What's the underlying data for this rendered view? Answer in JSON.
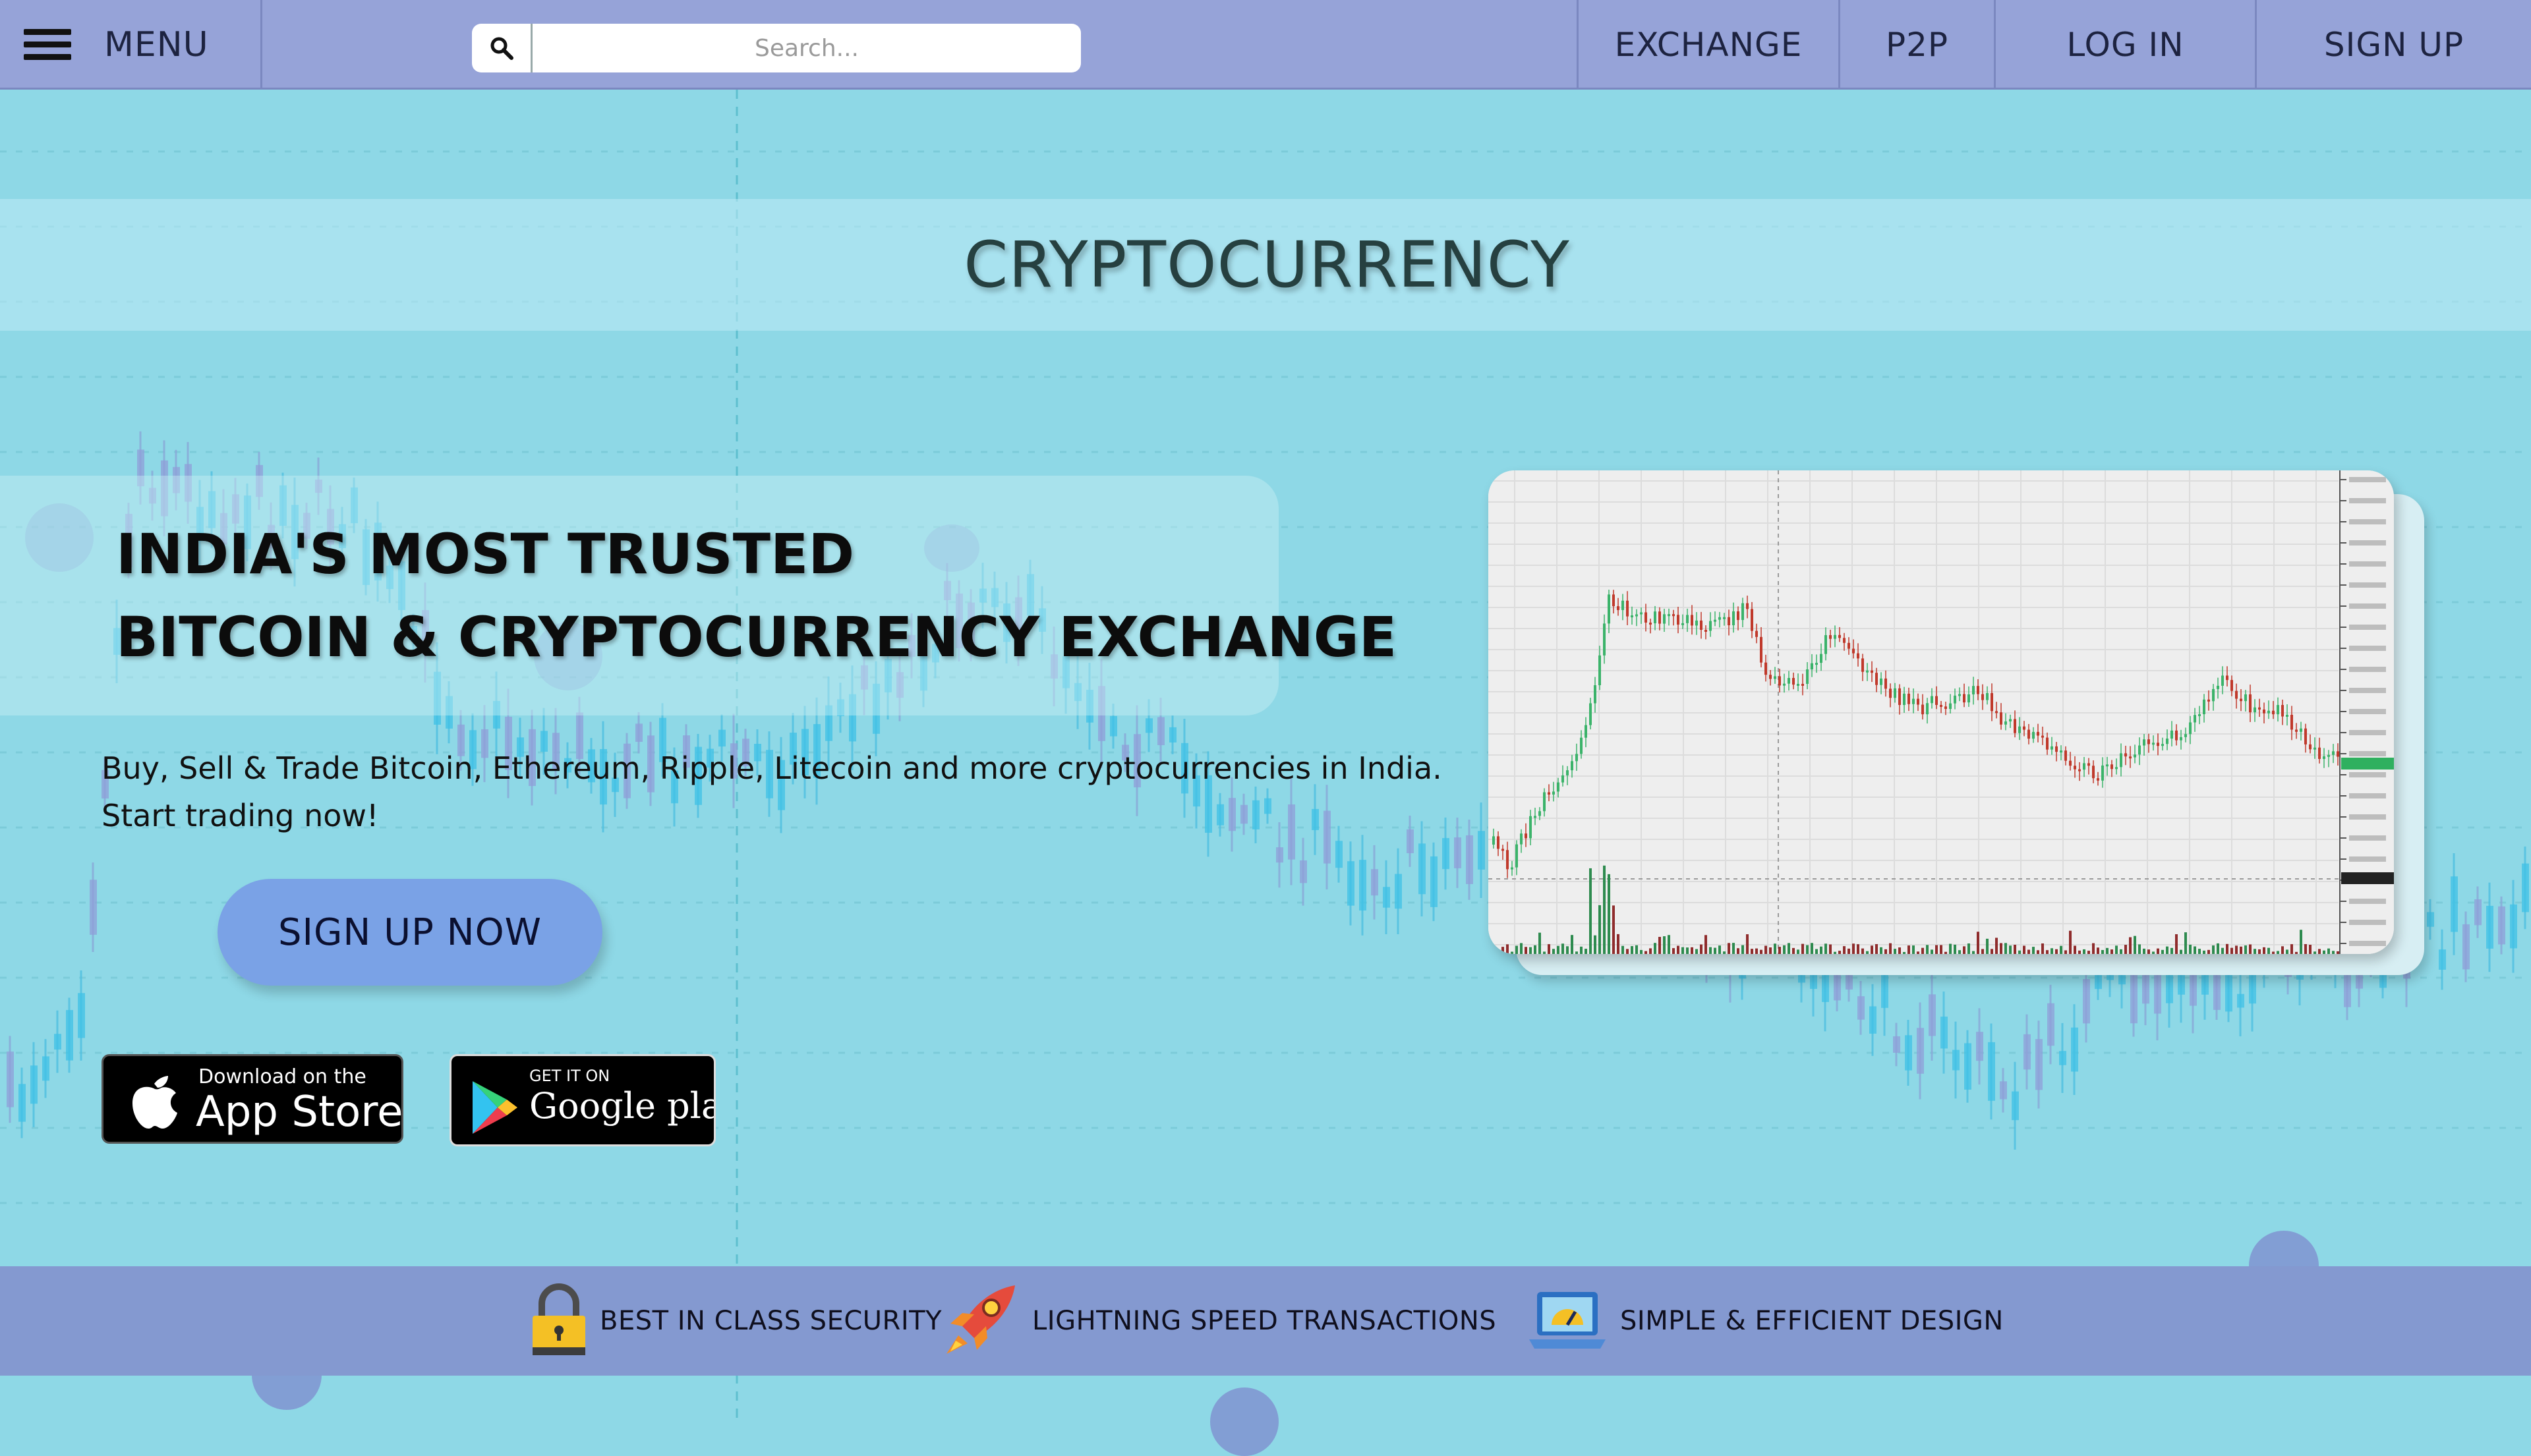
{
  "nav": {
    "menu_label": "MENU",
    "search_placeholder": "Search...",
    "links": {
      "exchange": "EXCHANGE",
      "p2p": "P2P",
      "login": "LOG IN",
      "signup": "SIGN UP"
    }
  },
  "hero": {
    "title": "CRYPTOCURRENCY",
    "headline_line1": "INDIA'S MOST TRUSTED",
    "headline_line2": "BITCOIN & CRYPTOCURRENCY EXCHANGE",
    "tagline_line1": "Buy, Sell & Trade Bitcoin, Ethereum, Ripple, Litecoin and more cryptocurrencies in India.",
    "tagline_line2": "Start trading now!",
    "cta_label": "SIGN UP NOW"
  },
  "store_badges": {
    "appstore_small": "Download on the",
    "appstore_big": "App Store",
    "googleplay_small": "GET IT ON",
    "googleplay_big": "Google play"
  },
  "features": [
    {
      "icon": "padlock-icon",
      "label": "BEST IN CLASS SECURITY"
    },
    {
      "icon": "rocket-icon",
      "label": "LIGHTNING SPEED TRANSACTIONS"
    },
    {
      "icon": "laptop-gauge-icon",
      "label": "SIMPLE & EFFICIENT DESIGN"
    }
  ],
  "colors": {
    "background": "#8ed8e6",
    "navbar": "#96a3d8",
    "cta": "#7aa2e6",
    "feature_bar": "#8499d0",
    "candle_up": "#3bb36a",
    "candle_down": "#c0392b"
  }
}
